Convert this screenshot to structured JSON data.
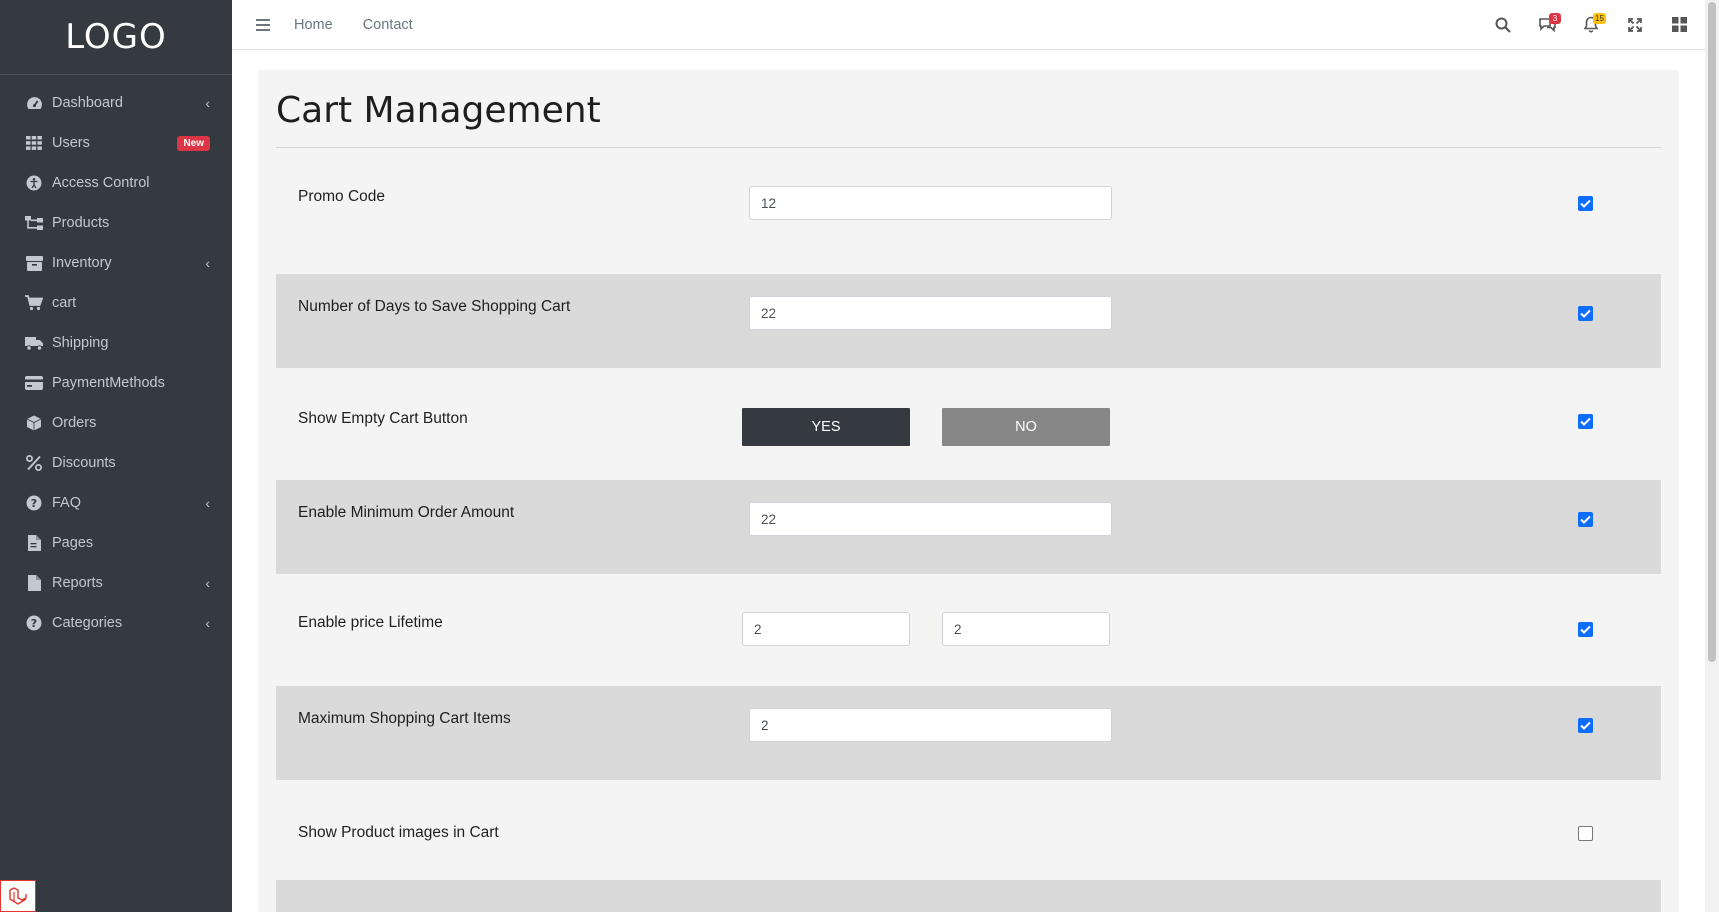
{
  "brand": {
    "logo_text": "LOGO"
  },
  "sidebar": {
    "items": [
      {
        "label": "Dashboard",
        "icon": "dashboard-icon",
        "chevron": true
      },
      {
        "label": "Users",
        "icon": "grid-icon",
        "badge": "New"
      },
      {
        "label": "Access Control",
        "icon": "accessibility-icon"
      },
      {
        "label": "Products",
        "icon": "sitemap-icon"
      },
      {
        "label": "Inventory",
        "icon": "box-icon",
        "chevron": true
      },
      {
        "label": "cart",
        "icon": "cart-icon"
      },
      {
        "label": "Shipping",
        "icon": "truck-icon"
      },
      {
        "label": "PaymentMethods",
        "icon": "credit-card-icon"
      },
      {
        "label": "Orders",
        "icon": "cube-icon"
      },
      {
        "label": "Discounts",
        "icon": "percent-icon"
      },
      {
        "label": "FAQ",
        "icon": "question-circle-icon",
        "chevron": true
      },
      {
        "label": "Pages",
        "icon": "file-icon"
      },
      {
        "label": "Reports",
        "icon": "report-file-icon",
        "chevron": true
      },
      {
        "label": "Categories",
        "icon": "question-circle-icon",
        "chevron": true
      }
    ]
  },
  "topbar": {
    "links": [
      "Home",
      "Contact"
    ],
    "messages_count": "3",
    "notifications_count": "15"
  },
  "page": {
    "title": "Cart Management"
  },
  "settings": [
    {
      "label": "Promo Code",
      "type": "input",
      "value": "12",
      "enabled": true
    },
    {
      "label": "Number of Days to Save Shopping Cart",
      "type": "input",
      "value": "22",
      "enabled": true
    },
    {
      "label": "Show Empty Cart Button",
      "type": "toggle",
      "yes_label": "YES",
      "no_label": "NO",
      "selected": "YES",
      "enabled": true
    },
    {
      "label": "Enable Minimum Order Amount",
      "type": "input",
      "value": "22",
      "enabled": true
    },
    {
      "label": "Enable price Lifetime",
      "type": "double-input",
      "value1": "2",
      "value2": "2",
      "enabled": true
    },
    {
      "label": "Maximum Shopping Cart Items",
      "type": "input",
      "value": "2",
      "enabled": true
    },
    {
      "label": "Show Product images in Cart",
      "type": "none",
      "enabled": false
    }
  ],
  "colors": {
    "sidebar_bg": "#343a40",
    "checkbox_accent": "#0d6efd",
    "badge_red": "#dc3545",
    "badge_yellow": "#ffc107"
  }
}
